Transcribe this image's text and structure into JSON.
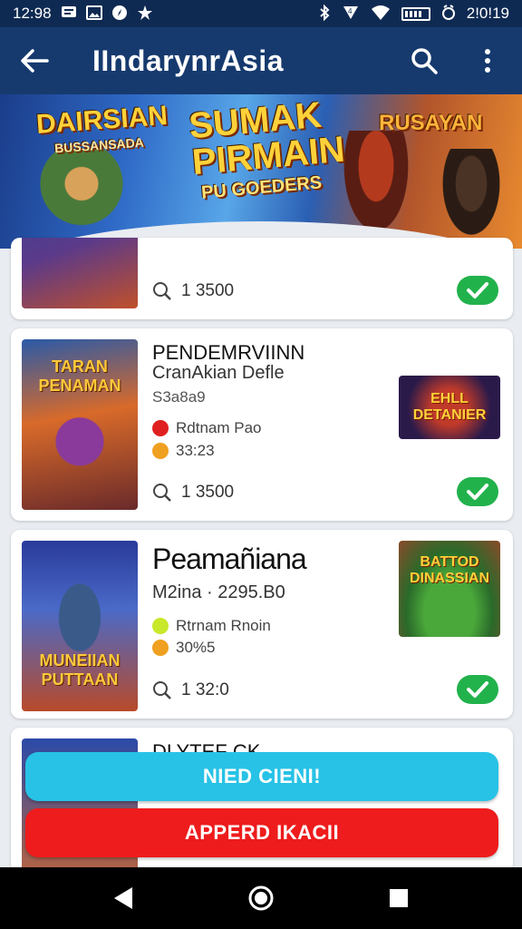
{
  "status_bar": {
    "time": "12:98",
    "right_text": "2!0!19",
    "icons": [
      "message-icon",
      "image-icon",
      "compass-icon",
      "star-icon",
      "bluetooth-icon",
      "signal-icon",
      "wifi-icon",
      "battery-icon",
      "alarm-icon"
    ]
  },
  "app_bar": {
    "title": "IIndarynrAsia",
    "back_icon": "arrow-left-icon",
    "search_icon": "search-icon",
    "more_icon": "more-vertical-icon"
  },
  "banner": {
    "left_title": "DAIRSIAN",
    "left_subtitle": "BUSSANSADA",
    "center_title_line1": "SUMAK",
    "center_title_line2": "PIRMAIN",
    "center_subtitle": "PU GOEDERS",
    "right_title": "RUSAYAN"
  },
  "cards": [
    {
      "rating": "1 3500",
      "checked": true
    },
    {
      "thumb_text": "TARAN PENAMAN",
      "title": "PENDEMRVIINN",
      "subtitle": "CranAkian Defle",
      "meta": "S3a8a9",
      "dot1_color": "#e02020",
      "dot1_text": "Rdtnam Pao",
      "dot2_color": "#f0a020",
      "dot2_text": "33:23",
      "rating": "1 3500",
      "side_text": "EHLL DETANIER",
      "checked": true
    },
    {
      "thumb_text": "MUNEIIAN PUTTAAN",
      "title": "Peamañiana",
      "subtitle": "M2ina · 2295.B0",
      "dot1_color": "#c8e82a",
      "dot1_text": "Rtrnam Rnoin",
      "dot2_color": "#f0a020",
      "dot2_text": "30%5",
      "rating": "1 32:0",
      "side_text": "BATTOD DINASSIAN",
      "checked": true
    },
    {
      "title": "DLYTEF CK"
    }
  ],
  "actions": {
    "primary_label": "NIED CIENI!",
    "primary_color": "#27c2e6",
    "secondary_label": "APPERD IKACII",
    "secondary_color": "#ee1c1c"
  },
  "nav": {
    "back_icon": "nav-back-icon",
    "home_icon": "nav-home-icon",
    "recents_icon": "nav-recents-icon"
  }
}
